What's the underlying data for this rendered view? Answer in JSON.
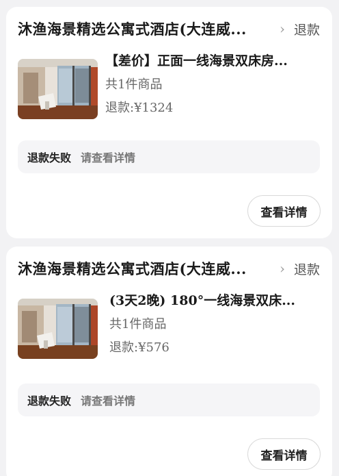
{
  "orders": [
    {
      "shop_name": "沐渔海景精选公寓式酒店(大连威...",
      "status": "退款",
      "product_title": "【差价】正面一线海景双床房...",
      "quantity": "共1件商品",
      "refund": "退款:¥1324",
      "fail_label": "退款失败",
      "fail_hint": "请查看详情",
      "detail_button": "查看详情"
    },
    {
      "shop_name": "沐渔海景精选公寓式酒店(大连威...",
      "status": "退款",
      "product_title": "(3天2晚) 180°一线海景双床...",
      "quantity": "共1件商品",
      "refund": "退款:¥576",
      "fail_label": "退款失败",
      "fail_hint": "请查看详情",
      "detail_button": "查看详情"
    }
  ],
  "icons": {
    "chevron": "chevron-right-icon"
  }
}
